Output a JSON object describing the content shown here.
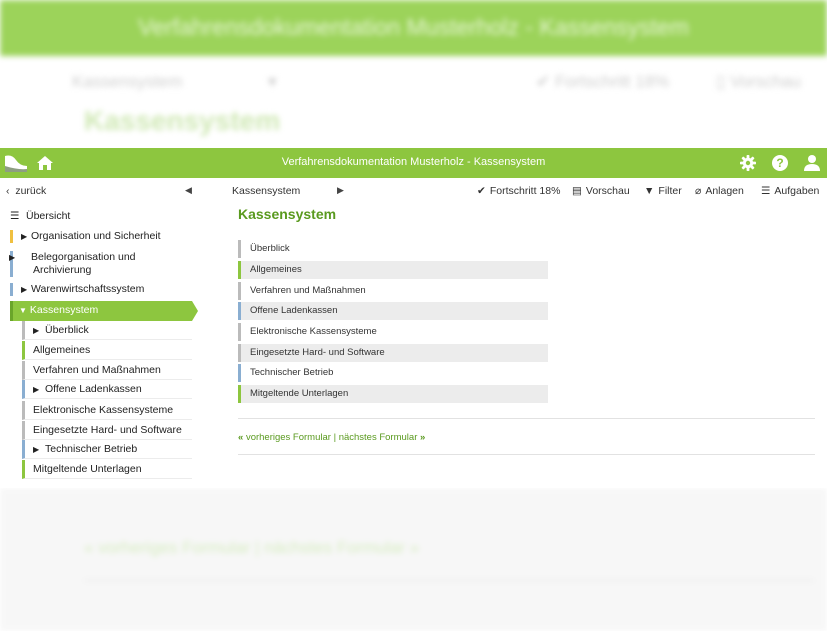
{
  "colors": {
    "brand_green": "#8dc63f",
    "title_green": "#5a9a1f",
    "marker_yellow": "#f0c040",
    "marker_blue": "#8aaed1",
    "marker_green": "#8dc63f",
    "marker_gray": "#bbbbbb"
  },
  "header": {
    "title": "Verfahrensdokumentation Musterholz - Kassensystem",
    "icons": [
      "logo-icon",
      "home-icon",
      "gear-icon",
      "help-icon",
      "user-icon"
    ]
  },
  "subbar": {
    "back_label": "zurück",
    "breadcrumb": "Kassensystem",
    "toolbar": [
      {
        "icon": "check-icon",
        "label": "Fortschritt 18%"
      },
      {
        "icon": "document-icon",
        "label": "Vorschau"
      },
      {
        "icon": "filter-icon",
        "label": "Filter"
      },
      {
        "icon": "paperclip-icon",
        "label": "Anlagen"
      },
      {
        "icon": "tasks-icon",
        "label": "Aufgaben"
      }
    ],
    "progress_percent": 18
  },
  "sidebar": {
    "overview_label": "Übersicht",
    "items": [
      {
        "label": "Organisation und Sicherheit",
        "marker": "yellow"
      },
      {
        "label": "Belegorganisation und Archivierung",
        "marker": "blue"
      },
      {
        "label": "Warenwirtschaftssystem",
        "marker": "blue"
      },
      {
        "label": "Kassensystem",
        "marker": "green",
        "active": true
      }
    ],
    "subitems": [
      {
        "label": "Überblick",
        "expandable": true,
        "marker": "gray"
      },
      {
        "label": "Allgemeines",
        "expandable": false,
        "marker": "green"
      },
      {
        "label": "Verfahren und Maßnahmen",
        "expandable": false,
        "marker": "gray"
      },
      {
        "label": "Offene Ladenkassen",
        "expandable": true,
        "marker": "blue"
      },
      {
        "label": "Elektronische Kassensysteme",
        "expandable": false,
        "marker": "gray"
      },
      {
        "label": "Eingesetzte Hard- und Software",
        "expandable": false,
        "marker": "gray"
      },
      {
        "label": "Technischer Betrieb",
        "expandable": true,
        "marker": "blue"
      },
      {
        "label": "Mitgeltende Unterlagen",
        "expandable": false,
        "marker": "green"
      }
    ]
  },
  "main": {
    "title": "Kassensystem",
    "list": [
      {
        "label": "Überblick",
        "marker": "gray"
      },
      {
        "label": "Allgemeines",
        "marker": "green"
      },
      {
        "label": "Verfahren und Maßnahmen",
        "marker": "gray"
      },
      {
        "label": "Offene Ladenkassen",
        "marker": "blue"
      },
      {
        "label": "Elektronische Kassensysteme",
        "marker": "gray"
      },
      {
        "label": "Eingesetzte Hard- und Software",
        "marker": "gray"
      },
      {
        "label": "Technischer Betrieb",
        "marker": "blue"
      },
      {
        "label": "Mitgeltende Unterlagen",
        "marker": "green"
      }
    ],
    "pager": {
      "prev_label": "vorheriges Formular",
      "separator": "|",
      "next_label": "nächstes Formular"
    }
  }
}
